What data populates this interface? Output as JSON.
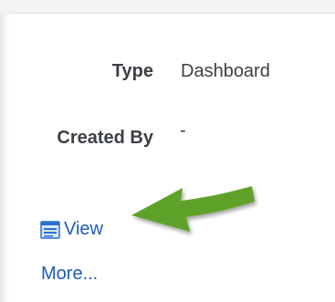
{
  "properties": {
    "type_label": "Type",
    "type_value": "Dashboard",
    "created_by_label": "Created By",
    "created_by_value": "-"
  },
  "actions": {
    "view_label": "View",
    "more_label": "More..."
  },
  "icons": {
    "view_icon": "dashboard-window-icon",
    "arrow": "green-pointer-arrow"
  },
  "colors": {
    "link": "#1f5bb8",
    "arrow": "#5ea22b",
    "text": "#3b3f45"
  }
}
